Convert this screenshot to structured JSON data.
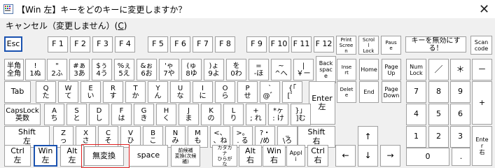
{
  "window": {
    "title": "【Win 左】キーをどのキーに変更しますか？",
    "close_glyph": "✕"
  },
  "menu": {
    "cancel_prefix": "キャンセル（変更しません）(",
    "cancel_key": "C",
    "cancel_suffix": ")"
  },
  "keys": {
    "esc": "Esc",
    "f1": "F 1",
    "f2": "F 2",
    "f3": "F 3",
    "f4": "F 4",
    "f5": "F 5",
    "f6": "F 6",
    "f7": "F 7",
    "f8": "F 8",
    "f9": "F 9",
    "f10": "F 10",
    "f11": "F 11",
    "f12": "F 12",
    "prtsc": [
      "Print",
      "Scree",
      "n"
    ],
    "scrlk": [
      "Scrol",
      "l",
      "Lock"
    ],
    "pause": [
      "Paus",
      "e"
    ],
    "disable": [
      "キーを無効にす",
      "る！"
    ],
    "scancode": [
      "Scan",
      "code"
    ],
    "hankaku": [
      "半角",
      "全角"
    ],
    "n1": [
      "!",
      "1ぬ"
    ],
    "n2": [
      "\"",
      "2ふ"
    ],
    "n3": [
      "#ぁ",
      "3あ"
    ],
    "n4": [
      "$ぅ",
      "4う"
    ],
    "n5": [
      "%ぇ",
      "5え"
    ],
    "n6": [
      "&ぉ",
      "6お"
    ],
    "n7": [
      "'ゃ",
      "7や"
    ],
    "n8": [
      "(ゅ",
      "8ゆ"
    ],
    "n9": [
      ")ょ",
      "9よ"
    ],
    "n0": [
      "を",
      "0わ"
    ],
    "minus": [
      "=",
      "-ほ"
    ],
    "caret": [
      "~",
      "^へ"
    ],
    "yen": [
      "|",
      "￥ー"
    ],
    "back": [
      "Back",
      "spac",
      "e"
    ],
    "ins": [
      "Inse",
      "rt"
    ],
    "home": "Home",
    "pgup": [
      "Page",
      "Up"
    ],
    "numlock": [
      "Num",
      "Lock"
    ],
    "nslash": "／",
    "nstar": "＊",
    "nminus": "－",
    "tab": "Tab",
    "q": [
      "Q",
      "た"
    ],
    "w": [
      "W",
      "て"
    ],
    "e": [
      "E",
      "い"
    ],
    "r": [
      "R",
      "す"
    ],
    "t": [
      "T",
      "か"
    ],
    "y": [
      "Y",
      "ん"
    ],
    "u": [
      "U",
      "な"
    ],
    "i": [
      "I",
      "に"
    ],
    "o": [
      "O",
      "ら"
    ],
    "p": [
      "P",
      "せ"
    ],
    "at": [
      "`",
      "@゛"
    ],
    "lbr": [
      "{「",
      "[゜"
    ],
    "enter": [
      "Enter",
      "左"
    ],
    "del": [
      "Delet",
      "e"
    ],
    "end": "End",
    "pgdn": [
      "Page",
      "Down"
    ],
    "n7k": "7",
    "n8k": "8",
    "n9k": "9",
    "nplus": "+",
    "caps": [
      "CapsLock",
      "英数"
    ],
    "a": [
      "A",
      "ち"
    ],
    "s": [
      "S",
      "と"
    ],
    "d": [
      "D",
      "し"
    ],
    "f": [
      "F",
      "は"
    ],
    "g": [
      "G",
      "き"
    ],
    "h": [
      "H",
      "く"
    ],
    "j": [
      "J",
      "ま"
    ],
    "k": [
      "K",
      "の"
    ],
    "l": [
      "L",
      "り"
    ],
    "semi": [
      "+",
      "; れ"
    ],
    "colon": [
      "*ヶ",
      ": け"
    ],
    "rbr": [
      "}」",
      "]む"
    ],
    "n4k": "4",
    "n5k": "5",
    "n6k": "6",
    "shiftl": [
      "Shift",
      "左"
    ],
    "z": [
      "Z",
      "っ"
    ],
    "x": [
      "X",
      "さ"
    ],
    "c": [
      "C",
      "そ"
    ],
    "v": [
      "V",
      "ひ"
    ],
    "b": [
      "B",
      "こ"
    ],
    "n": [
      "N",
      "み"
    ],
    "m": [
      "M",
      "も"
    ],
    "comma": [
      "<、",
      "、ね"
    ],
    "period": [
      ">。",
      ". る"
    ],
    "slash": [
      "?・",
      "/め"
    ],
    "ro": [
      "_",
      "\\ろ"
    ],
    "shiftr": [
      "Shift",
      "右"
    ],
    "up": "↑",
    "n1k": "1",
    "n2k": "2",
    "n3k": "3",
    "nenter": [
      "Ente",
      "r",
      "右"
    ],
    "ctrll": [
      "Ctrl",
      "左"
    ],
    "winl": [
      "Win",
      "左"
    ],
    "altl": [
      "Alt",
      "左"
    ],
    "muhenkan": "無変換",
    "space": "space",
    "henkan": [
      "前候補",
      "変換(次候",
      "補)"
    ],
    "kana": [
      "カタカ",
      "ナ",
      "ひらが",
      "な"
    ],
    "altr": [
      "Alt",
      "右"
    ],
    "winr": [
      "Win",
      "右"
    ],
    "apps": [
      "Appl",
      "i"
    ],
    "ctrlr": [
      "Ctrl",
      "右"
    ],
    "left": "←",
    "down": "↓",
    "right": "→",
    "n0k": "0",
    "ndot": "."
  }
}
